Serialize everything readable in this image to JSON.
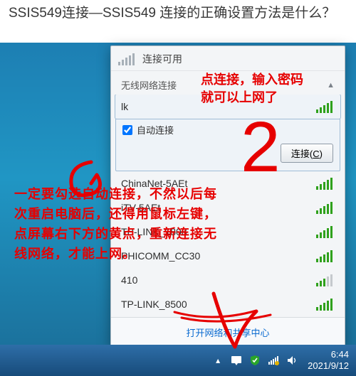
{
  "title": "SSIS549连接—SSIS549 连接的正确设置方法是什么？",
  "popup": {
    "header": "连接可用",
    "section_label": "无线网络连接",
    "auto_connect_label": "自动连接",
    "connect_button_label": "连接",
    "connect_button_key": "C",
    "footer_link": "打开网络和共享中心",
    "networks": [
      {
        "ssid": "lk",
        "selected": true,
        "auto": true
      },
      {
        "ssid": "ChinaNet-5AEt"
      },
      {
        "ssid": "iTV-5AEt"
      },
      {
        "ssid": "TP-LINK_1808"
      },
      {
        "ssid": "PHICOMM_CC30"
      },
      {
        "ssid": "410",
        "weak": true
      },
      {
        "ssid": "TP-LINK_8500"
      }
    ]
  },
  "taskbar": {
    "time": "6:44",
    "date": "2021/9/12"
  },
  "annotations": {
    "top": "点连接，输入密码\n就可以上网了",
    "mid": "一定要勾选自动连接，不然以后每次重启电脑后，还得用鼠标左键，点屏幕右下方的黄点，重新连接无线网络，才能上网。"
  }
}
